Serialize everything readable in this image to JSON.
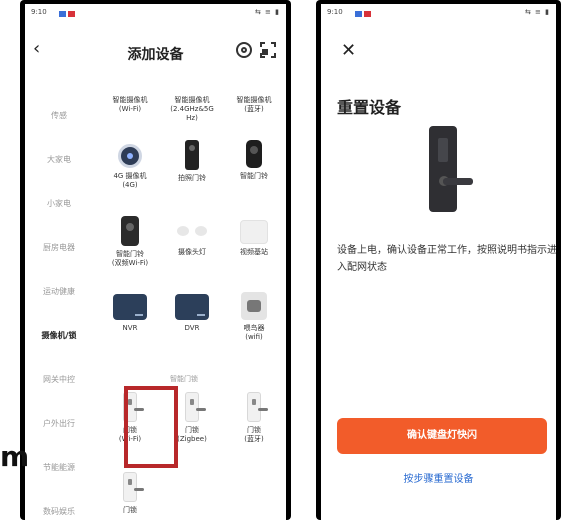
{
  "left_screen": {
    "status": {
      "time": "9:10",
      "right": "⇆ ≡ ▮"
    },
    "title": "添加设备",
    "sidebar": [
      {
        "label": "传感"
      },
      {
        "label": "大家电"
      },
      {
        "label": "小家电"
      },
      {
        "label": "厨房电器"
      },
      {
        "label": "运动健康"
      },
      {
        "label": "摄像机/锁",
        "active": true
      },
      {
        "label": "网关中控"
      },
      {
        "label": "户外出行"
      },
      {
        "label": "节能能源"
      },
      {
        "label": "数码娱乐"
      }
    ],
    "devices": [
      {
        "name": "智能摄像机\n(Wi-Fi)",
        "icon": "camera-dome-icon"
      },
      {
        "name": "智能摄像机\n(2.4GHz&5G\nHz)",
        "icon": "camera-dome-icon"
      },
      {
        "name": "智能摄像机\n(蓝牙)",
        "icon": "camera-dome-icon"
      },
      {
        "name": "4G 摄像机\n(4G)",
        "icon": "camera-dome-icon"
      },
      {
        "name": "拍照门铃",
        "icon": "doorbell-icon"
      },
      {
        "name": "智能门铃",
        "icon": "doorbell-icon"
      },
      {
        "name": "智能门铃\n(双频Wi-Fi)",
        "icon": "doorbell-icon"
      },
      {
        "name": "摄像头灯",
        "icon": "floodlight-icon"
      },
      {
        "name": "视频基站",
        "icon": "base-station-icon"
      },
      {
        "name": "NVR",
        "icon": "nvr-icon"
      },
      {
        "name": "DVR",
        "icon": "dvr-icon"
      },
      {
        "name": "喂鸟器\n(wifi)",
        "icon": "bird-feeder-icon"
      }
    ],
    "section_label": "智能门锁",
    "locks": [
      {
        "name": "门锁\n(Wi-Fi)",
        "icon": "door-lock-icon"
      },
      {
        "name": "门锁\n(Zigbee)",
        "icon": "door-lock-icon"
      },
      {
        "name": "门锁\n(蓝牙)",
        "icon": "door-lock-icon"
      },
      {
        "name": "门锁",
        "icon": "door-lock-icon"
      }
    ],
    "overlay_letter": "m"
  },
  "right_screen": {
    "status": {
      "time": "9:10",
      "right": "⇆ ≡ ▮"
    },
    "title": "重置设备",
    "instruction": "设备上电，确认设备正常工作，按照说明书指示进入配网状态",
    "confirm_button": "确认键盘灯快闪",
    "step_link": "按步骤重置设备"
  },
  "colors": {
    "accent_button": "#f25c2a",
    "link": "#2a6bd1",
    "highlight_box": "#b8282a"
  }
}
